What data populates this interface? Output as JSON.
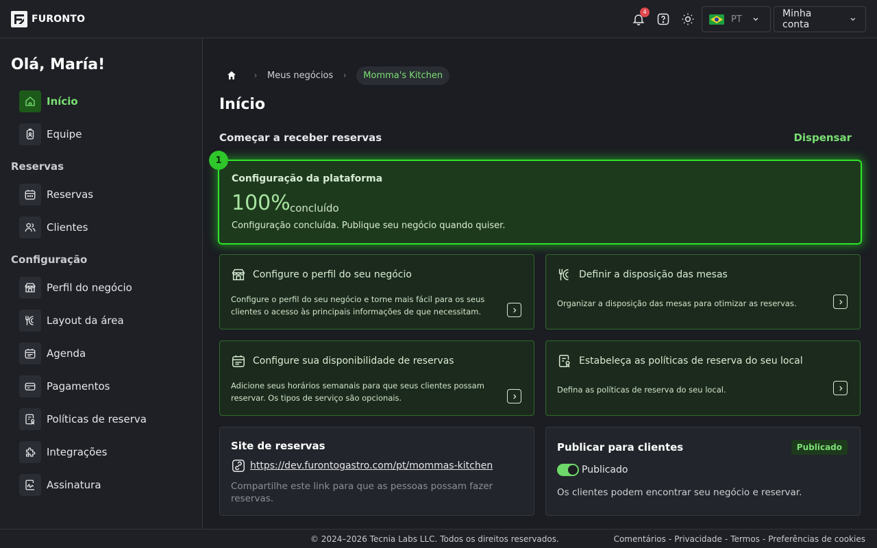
{
  "header": {
    "brand": "FURONTO",
    "notifications_count": "4",
    "language": "PT",
    "account_label": "Minha conta"
  },
  "sidebar": {
    "greeting": "Olá, María!",
    "items_main": [
      {
        "label": "Início",
        "icon": "home-icon",
        "active": true
      },
      {
        "label": "Equipe",
        "icon": "badge-icon"
      }
    ],
    "section_reservas": "Reservas",
    "items_reservas": [
      {
        "label": "Reservas",
        "icon": "calendar-icon"
      },
      {
        "label": "Clientes",
        "icon": "users-icon"
      }
    ],
    "section_config": "Configuração",
    "items_config": [
      {
        "label": "Perfil do negócio",
        "icon": "store-icon"
      },
      {
        "label": "Layout da área",
        "icon": "cutlery-icon"
      },
      {
        "label": "Agenda",
        "icon": "schedule-icon"
      },
      {
        "label": "Pagamentos",
        "icon": "card-icon"
      },
      {
        "label": "Políticas de reserva",
        "icon": "policy-icon"
      },
      {
        "label": "Integrações",
        "icon": "puzzle-icon"
      },
      {
        "label": "Assinatura",
        "icon": "signature-icon"
      }
    ]
  },
  "breadcrumb": {
    "items": [
      "Meus negócios",
      "Momma's Kitchen"
    ]
  },
  "main": {
    "title": "Início",
    "section_title": "Começar a receber reservas",
    "dismiss_label": "Dispensar",
    "progress": {
      "step": "1",
      "title": "Configuração da plataforma",
      "percent": "100%",
      "percent_value": 100,
      "done_label": "concluído",
      "description": "Configuração concluída. Publique seu negócio quando quiser."
    },
    "tasks": [
      {
        "title": "Configure o perfil do seu negócio",
        "description": "Configure o perfil do seu negócio e torne mais fácil para os seus clientes o acesso às principais informações de que necessitam.",
        "icon": "store-icon"
      },
      {
        "title": "Definir a disposição das mesas",
        "description": "Organizar a disposição das mesas para otimizar as reservas.",
        "icon": "cutlery-icon"
      },
      {
        "title": "Configure sua disponibilidade de reservas",
        "description": "Adicione seus horários semanais para que seus clientes possam reservar. Os tipos de serviço são opcionais.",
        "icon": "schedule-icon"
      },
      {
        "title": "Estabeleça as políticas de reserva do seu local",
        "description": "Defina as políticas de reserva do seu local.",
        "icon": "policy-icon"
      }
    ],
    "site": {
      "title": "Site de reservas",
      "url": "https://dev.furontogastro.com/pt/mommas-kitchen",
      "description": "Compartilhe este link para que as pessoas possam fazer reservas."
    },
    "publish": {
      "title": "Publicar para clientes",
      "badge": "Publicado",
      "toggle_label": "Publicado",
      "toggle_on": true,
      "description": "Os clientes podem encontrar seu negócio e reservar."
    }
  },
  "footer": {
    "copyright": "© 2024–2026 Tecnia Labs LLC. Todos os direitos reservados.",
    "links": [
      "Comentários",
      "Privacidade",
      "Termos",
      "Preferências de cookies"
    ],
    "separator": "-"
  },
  "colors": {
    "accent": "#7ae073",
    "glow": "#2ee52a",
    "background": "#1b1d22",
    "badge_red": "#e0474c"
  }
}
